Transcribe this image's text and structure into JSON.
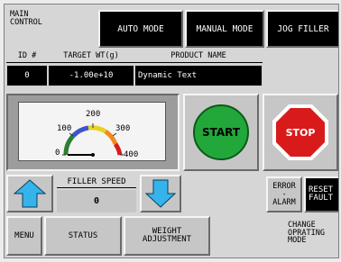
{
  "title": "MAIN\nCONTROL",
  "mode_buttons": {
    "auto": "AUTO MODE",
    "manual": "MANUAL MODE",
    "jog": "JOG FILLER"
  },
  "table": {
    "headers": {
      "id": "ID #",
      "target": "TARGET WT(g)",
      "product": "PRODUCT NAME"
    },
    "row": {
      "id": "0",
      "target": "-1.00e+10",
      "product": "Dynamic Text"
    }
  },
  "gauge": {
    "ticks": [
      "0",
      "100",
      "200",
      "300",
      "400"
    ],
    "value": 0,
    "range": [
      0,
      400
    ]
  },
  "start_label": "START",
  "stop_label": "STOP",
  "filler_speed": {
    "label": "FILLER SPEED",
    "value": "0"
  },
  "error_alarm_label": "ERROR\n-\nALARM",
  "reset_fault_label": "RESET\nFAULT",
  "bottom": {
    "menu": "MENU",
    "status": "STATUS",
    "weight_adjust": "WEIGHT\nADJUSTMENT",
    "change_mode": "CHANGE\nOPRATING\nMODE"
  },
  "colors": {
    "start_green": "#22a83a",
    "stop_red": "#d91a1a",
    "arrow_cyan": "#35b4ec"
  }
}
